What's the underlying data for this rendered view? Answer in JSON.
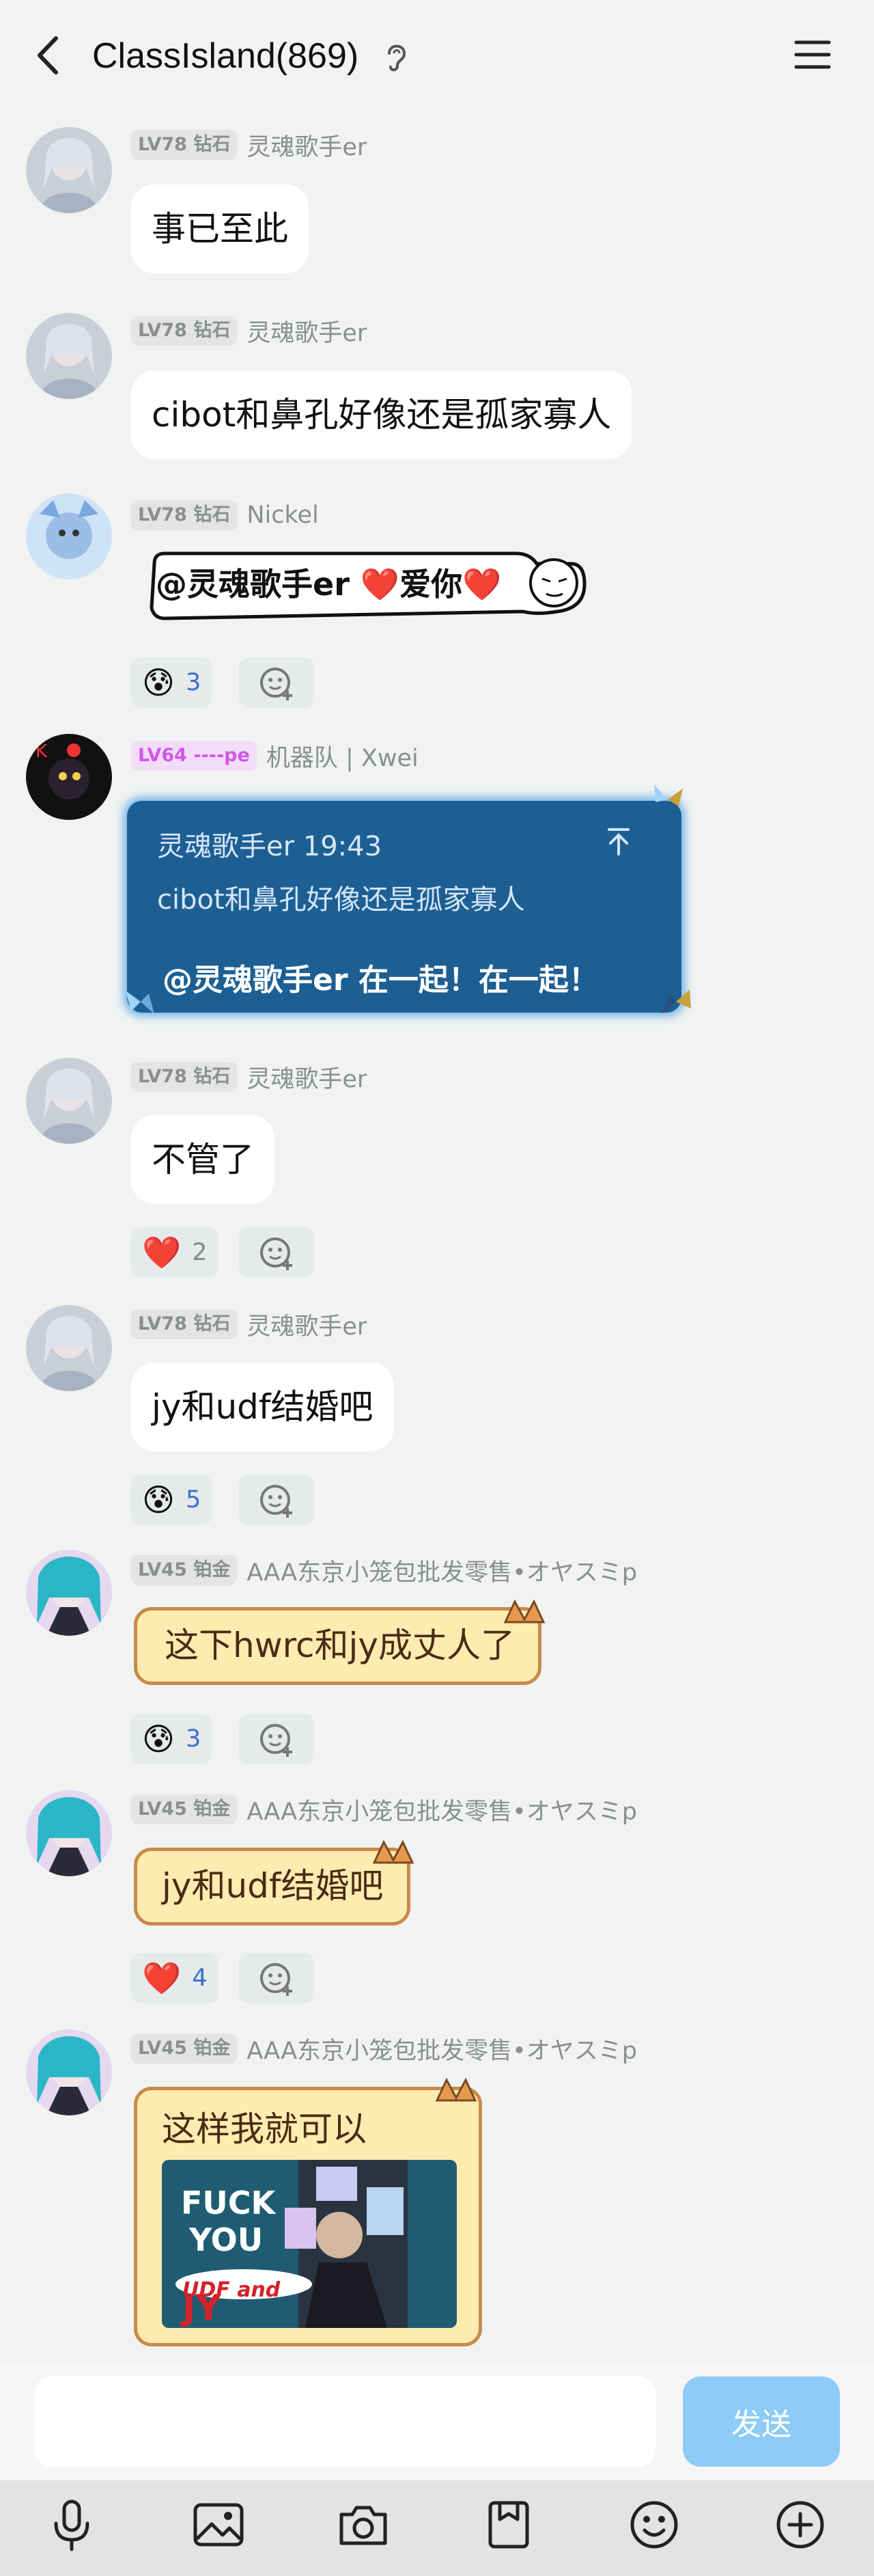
{
  "header": {
    "title": "ClassIsland(869)"
  },
  "messages": [
    {
      "level": "LV78 钻石",
      "name": "灵魂歌手er",
      "text": "事已至此"
    },
    {
      "level": "LV78 钻石",
      "name": "灵魂歌手er",
      "text": "cibot和鼻孔好像还是孤家寡人"
    },
    {
      "level": "LV78 钻石",
      "name": "Nickel",
      "mention": "@灵魂歌手er",
      "love1": "❤️",
      "love_text": "爱你",
      "love2": "❤️",
      "reaction": {
        "emoji": "😰",
        "count": "3"
      }
    },
    {
      "level": "LV64 ----pe",
      "name": "机器队 | Xwei",
      "quote_author_time": "灵魂歌手er 19:43",
      "quote_text": "cibot和鼻孔好像还是孤家寡人",
      "reply_text": "@灵魂歌手er 在一起！在一起！"
    },
    {
      "level": "LV78 钻石",
      "name": "灵魂歌手er",
      "text": "不管了",
      "reaction": {
        "emoji": "❤️",
        "count": "2"
      }
    },
    {
      "level": "LV78 钻石",
      "name": "灵魂歌手er",
      "text": "jy和udf结婚吧",
      "reaction": {
        "emoji": "😰",
        "count": "5"
      }
    },
    {
      "level": "LV45 铂金",
      "name": "AAA东京小笼包批发零售•オヤスミp",
      "text": "这下hwrc和jy成丈人了",
      "reaction": {
        "emoji": "😰",
        "count": "3"
      }
    },
    {
      "level": "LV45 铂金",
      "name": "AAA东京小笼包批发零售•オヤスミp",
      "text": "jy和udf结婚吧",
      "reaction": {
        "emoji": "❤️",
        "count": "4"
      }
    },
    {
      "level": "LV45 铂金",
      "name": "AAA东京小笼包批发零售•オヤスミp",
      "text": "这样我就可以",
      "image_text1": "FUCK",
      "image_text2": "YOU",
      "image_text3": "UDF and",
      "image_text4": "JY"
    }
  ],
  "input": {
    "placeholder": "",
    "send_label": "发送"
  },
  "toolbar": [
    "mic-icon",
    "image-icon",
    "camera-icon",
    "folder-icon",
    "emoji-icon",
    "plus-icon"
  ],
  "colors": {
    "background": "#f0f3f2",
    "send": "#8ecbf7",
    "reaction_count": "#3b6fd0",
    "cat_bubble": "#fdebb0",
    "quote_card": "#1d5f93"
  }
}
